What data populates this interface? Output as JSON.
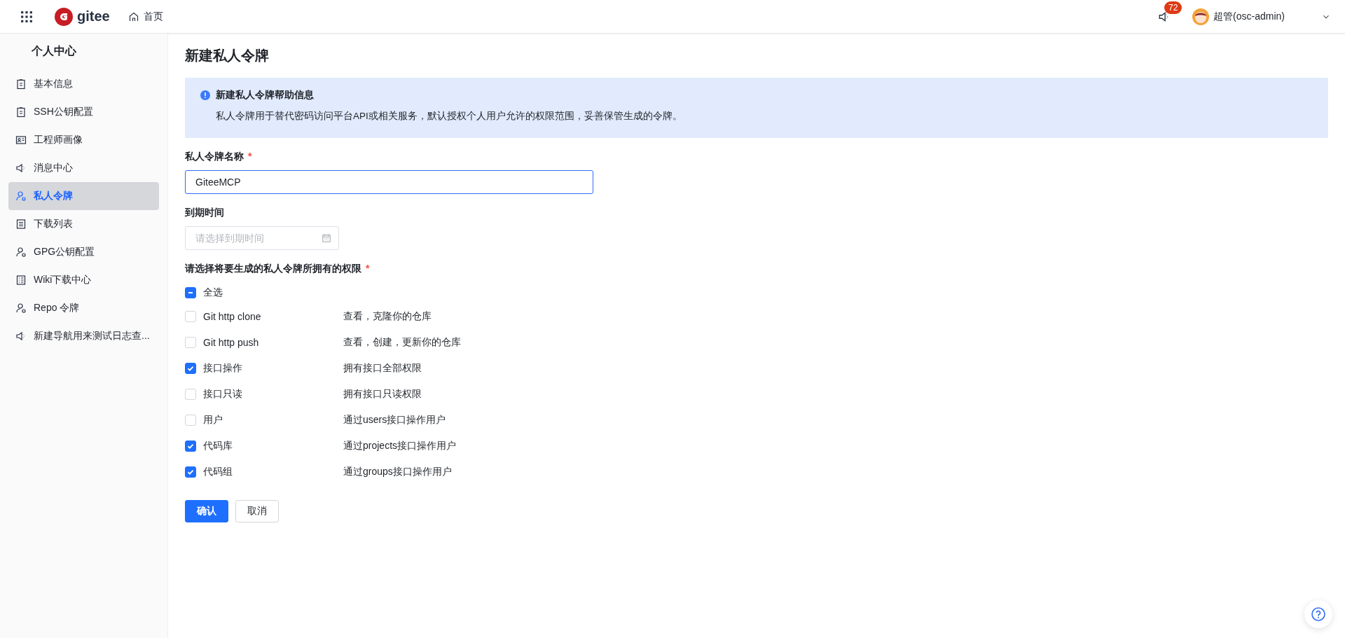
{
  "topbar": {
    "logo_text": "gitee",
    "home_link": "首页",
    "notification_count": "72",
    "user_name": "超管(osc-admin)"
  },
  "sidebar": {
    "title": "个人中心",
    "items": [
      {
        "label": "基本信息",
        "selected": false
      },
      {
        "label": "SSH公钥配置",
        "selected": false
      },
      {
        "label": "工程师画像",
        "selected": false
      },
      {
        "label": "消息中心",
        "selected": false
      },
      {
        "label": "私人令牌",
        "selected": true
      },
      {
        "label": "下载列表",
        "selected": false
      },
      {
        "label": "GPG公钥配置",
        "selected": false
      },
      {
        "label": "Wiki下载中心",
        "selected": false
      },
      {
        "label": "Repo 令牌",
        "selected": false
      },
      {
        "label": "新建导航用来测试日志查...",
        "selected": false
      }
    ]
  },
  "page_title": "新建私人令牌",
  "info": {
    "title": "新建私人令牌帮助信息",
    "text": "私人令牌用于替代密码访问平台API或相关服务，默认授权个人用户允许的权限范围，妥善保管生成的令牌。"
  },
  "form": {
    "name_field": {
      "label": "私人令牌名称",
      "required_mark": "*",
      "value": "GiteeMCP",
      "focused": true
    },
    "expiry_field": {
      "label": "到期时间",
      "placeholder": "请选择到期时间"
    },
    "permissions": {
      "label": "请选择将要生成的私人令牌所拥有的权限",
      "required_mark": "*",
      "select_all": {
        "label": "全选",
        "indeterminate": true
      },
      "items": [
        {
          "label": "Git http clone",
          "description": "查看，克隆你的仓库",
          "checked": false
        },
        {
          "label": "Git http push",
          "description": "查看，创建，更新你的仓库",
          "checked": false
        },
        {
          "label": "接口操作",
          "description": "拥有接口全部权限",
          "checked": true
        },
        {
          "label": "接口只读",
          "description": "拥有接口只读权限",
          "checked": false
        },
        {
          "label": "用户",
          "description": "通过users接口操作用户",
          "checked": false
        },
        {
          "label": "代码库",
          "description": "通过projects接口操作用户",
          "checked": true
        },
        {
          "label": "代码组",
          "description": "通过groups接口操作用户",
          "checked": true
        }
      ]
    }
  },
  "buttons": [
    {
      "label": "确认",
      "kind": "primary"
    },
    {
      "label": "取消",
      "kind": "default"
    }
  ]
}
